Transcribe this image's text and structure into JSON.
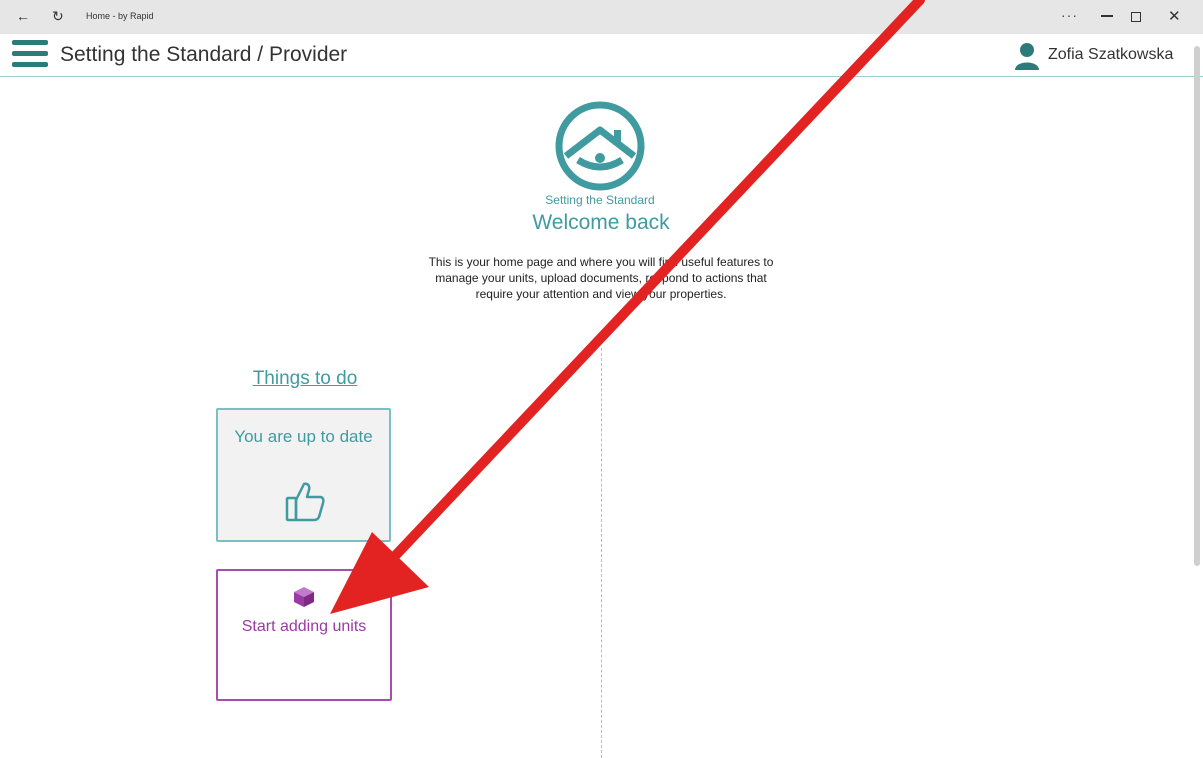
{
  "window": {
    "title": "Home - by Rapid",
    "back_glyph": "←",
    "refresh_glyph": "↻",
    "more_glyph": "···",
    "close_glyph": "✕"
  },
  "header": {
    "title": "Setting the Standard / Provider",
    "user_name": "Zofia Szatkowska"
  },
  "welcome": {
    "logo_text": "Setting the Standard",
    "heading": "Welcome back",
    "intro": "This is your home page and where you will find useful features to manage your units, upload documents, respond to actions that require your attention and view your properties."
  },
  "things_to_do": {
    "title": "Things to do",
    "up_to_date": "You are up to date",
    "start_units": "Start adding units"
  },
  "colors": {
    "teal": "#3f9ba0",
    "dark_teal": "#2d7a7a",
    "purple": "#9b3aa3",
    "annotation_red": "#e32222"
  },
  "icons": [
    "back-arrow-icon",
    "refresh-icon",
    "more-icon",
    "minimize-icon",
    "maximize-icon",
    "close-icon",
    "hamburger-menu-icon",
    "user-icon",
    "house-logo-icon",
    "thumbs-up-icon",
    "cube-icon"
  ]
}
